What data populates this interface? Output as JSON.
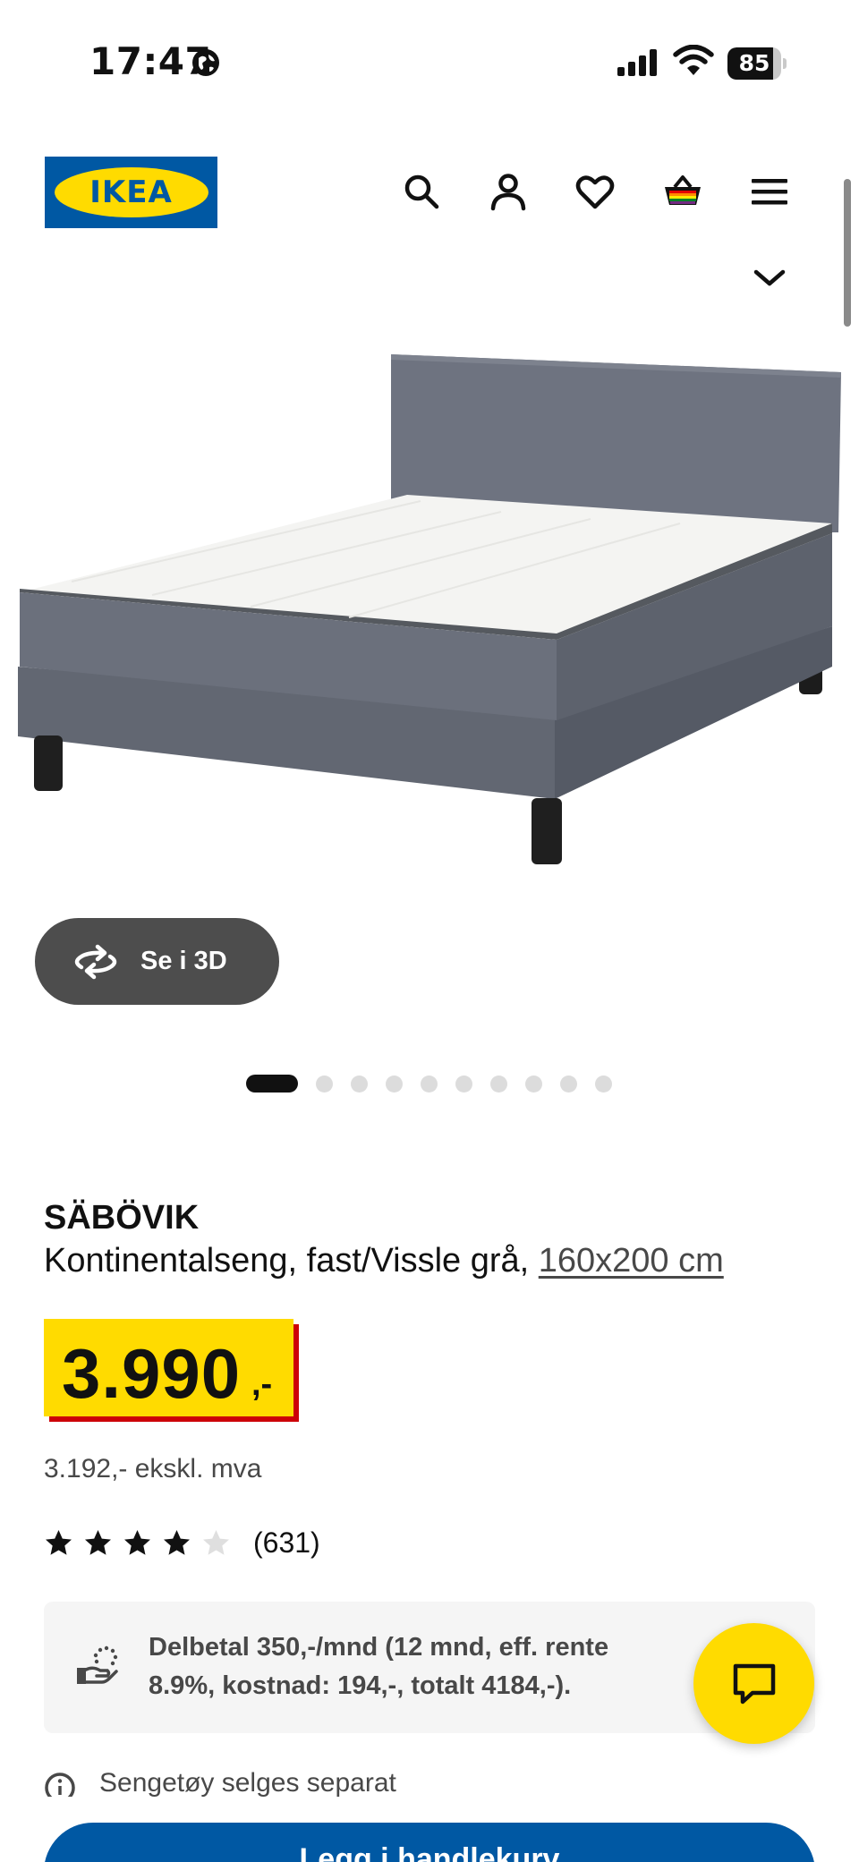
{
  "status_bar": {
    "time": "17:47",
    "battery_level": "85",
    "battery_fraction": 0.85,
    "icons": [
      "globe-icon",
      "signal-icon",
      "wifi-icon",
      "battery-icon"
    ]
  },
  "header": {
    "logo_text": "IKEA",
    "icons": [
      "search-icon",
      "account-icon",
      "heart-icon",
      "cart-icon",
      "menu-icon",
      "chevron-down-icon"
    ]
  },
  "gallery": {
    "view_3d_label": "Se i 3D",
    "dot_count": 10,
    "active_index": 0
  },
  "product": {
    "name": "SÄBÖVIK",
    "description": "Kontinentalseng, fast/Vissle grå, ",
    "size": "160x200 cm",
    "price": "3.990",
    "price_suffix": ",-",
    "price_ex_vat": "3.192,- ekskl. mva",
    "rating": 4,
    "rating_max": 5,
    "review_count": "(631)"
  },
  "installment": {
    "text": "Delbetal 350,-/mnd (12 mnd, eff. rente 8.9%, kostnad: 194,-, totalt 4184,-)."
  },
  "notice": {
    "text": "Sengetøy selges separat"
  },
  "add_to_cart": {
    "label": "Legg i handlekurv"
  },
  "colors": {
    "ikea_blue": "#0058a3",
    "ikea_yellow": "#ffdb00",
    "price_red": "#cc0008",
    "dark_button": "#4d4d4d"
  }
}
